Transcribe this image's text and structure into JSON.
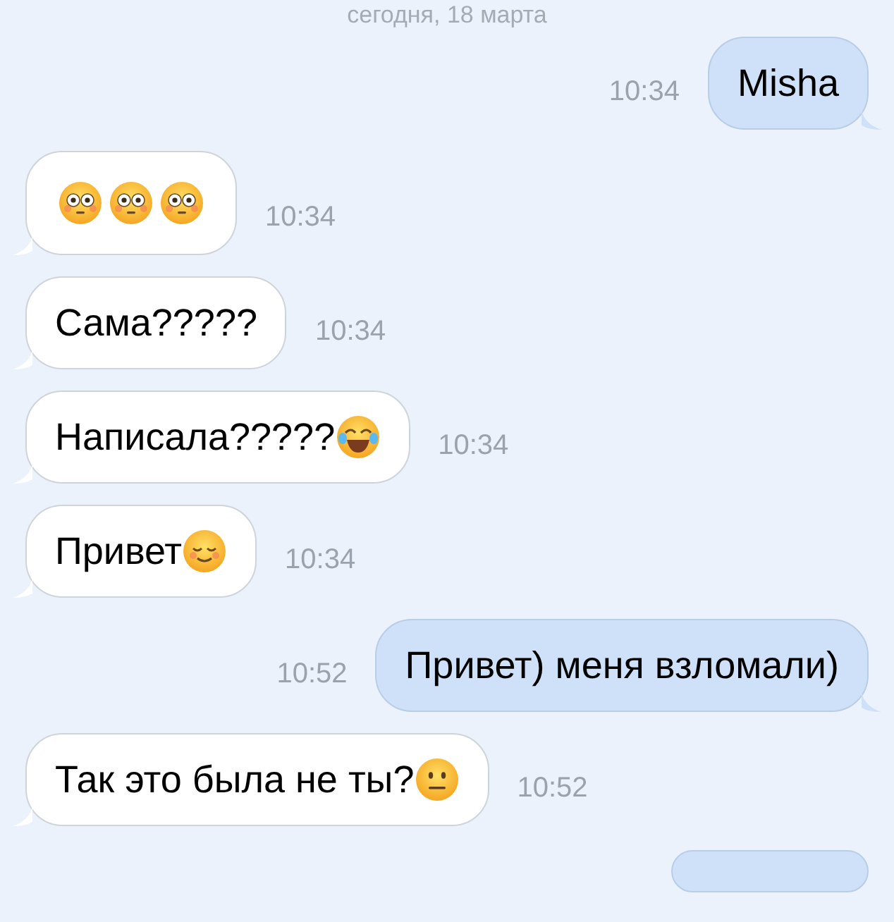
{
  "date_header": "сегодня, 18 марта",
  "messages": [
    {
      "kind": "outgoing",
      "text": "Misha",
      "time": "10:34"
    },
    {
      "kind": "incoming",
      "emoji": [
        {
          "kind": "flushed"
        },
        {
          "kind": "flushed"
        },
        {
          "kind": "flushed"
        }
      ],
      "time": "10:34"
    },
    {
      "kind": "incoming",
      "text": "Сама?????",
      "time": "10:34"
    },
    {
      "kind": "incoming",
      "text": "Написала?????",
      "emoji": [
        {
          "kind": "joy"
        }
      ],
      "time": "10:34"
    },
    {
      "kind": "incoming",
      "text": "Привет",
      "emoji": [
        {
          "kind": "smiling"
        }
      ],
      "time": "10:34"
    },
    {
      "kind": "outgoing",
      "text": "Привет) меня взломали)",
      "time": "10:52"
    },
    {
      "kind": "incoming",
      "text": "Так это была не ты?",
      "emoji": [
        {
          "kind": "neutral"
        }
      ],
      "time": "10:52"
    },
    {
      "kind": "cut"
    }
  ]
}
